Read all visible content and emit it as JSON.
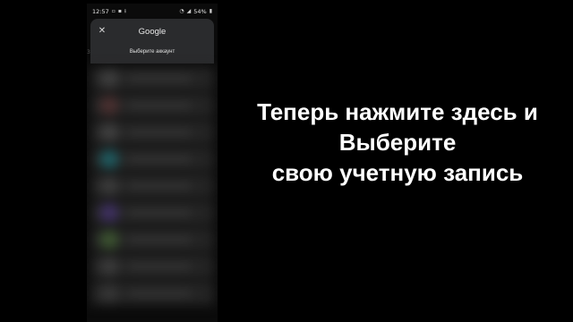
{
  "status_bar": {
    "time": "12:57",
    "battery": "54%"
  },
  "account_dialog": {
    "title": "Google",
    "subtitle": "Выберите аккаунт",
    "close_icon": "close-icon"
  },
  "side_digit": "3",
  "caption": {
    "line1": "Теперь нажмите здесь и",
    "line2": "Выберите",
    "line3": "свою учетную запись"
  },
  "colors": {
    "background": "#000000",
    "dialog": "#2a2b2d",
    "caption_text": "#ffffff"
  }
}
